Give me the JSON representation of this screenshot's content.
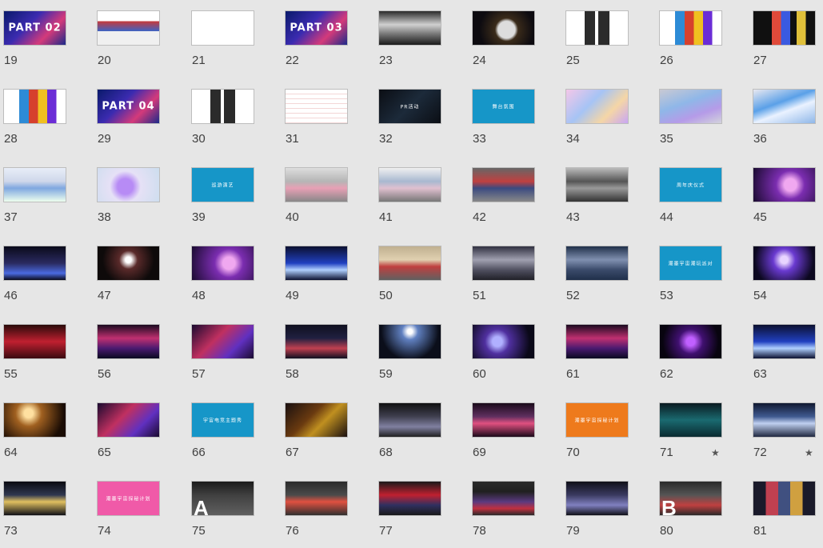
{
  "slides": [
    {
      "number": "19",
      "style": "s-space",
      "caption": "PART 02",
      "caption_size": "big"
    },
    {
      "number": "20",
      "style": "s-white-doc",
      "caption": ""
    },
    {
      "number": "21",
      "style": "s-white-pills",
      "caption": ""
    },
    {
      "number": "22",
      "style": "s-space",
      "caption": "PART 03",
      "caption_size": "big"
    },
    {
      "number": "23",
      "style": "s-robot2",
      "caption": ""
    },
    {
      "number": "24",
      "style": "s-astro",
      "caption": ""
    },
    {
      "number": "25",
      "style": "s-white-grid",
      "caption": ""
    },
    {
      "number": "26",
      "style": "s-white-color",
      "caption": ""
    },
    {
      "number": "27",
      "style": "s-posters",
      "caption": ""
    },
    {
      "number": "28",
      "style": "s-white-color",
      "caption": ""
    },
    {
      "number": "29",
      "style": "s-space",
      "caption": "PART 04",
      "caption_size": "big"
    },
    {
      "number": "30",
      "style": "s-white-grid",
      "caption": ""
    },
    {
      "number": "31",
      "style": "s-white-lines",
      "caption": ""
    },
    {
      "number": "32",
      "style": "s-tech",
      "caption": "PR活动"
    },
    {
      "number": "33",
      "style": "s-blue",
      "caption": "舞台氛围"
    },
    {
      "number": "34",
      "style": "s-pastel",
      "caption": ""
    },
    {
      "number": "35",
      "style": "s-inflat",
      "caption": ""
    },
    {
      "number": "36",
      "style": "s-inflat2",
      "caption": ""
    },
    {
      "number": "37",
      "style": "s-dome",
      "caption": ""
    },
    {
      "number": "38",
      "style": "s-planet",
      "caption": ""
    },
    {
      "number": "39",
      "style": "s-blue",
      "caption": "巡游演艺"
    },
    {
      "number": "40",
      "style": "s-mall",
      "caption": ""
    },
    {
      "number": "41",
      "style": "s-mall2",
      "caption": ""
    },
    {
      "number": "42",
      "style": "s-crowd",
      "caption": ""
    },
    {
      "number": "43",
      "style": "s-crowd2",
      "caption": ""
    },
    {
      "number": "44",
      "style": "s-blue",
      "caption": "周年庆仪式"
    },
    {
      "number": "45",
      "style": "s-purple",
      "caption": ""
    },
    {
      "number": "46",
      "style": "s-stage",
      "caption": ""
    },
    {
      "number": "47",
      "style": "s-stage2",
      "caption": ""
    },
    {
      "number": "48",
      "style": "s-purple",
      "caption": ""
    },
    {
      "number": "49",
      "style": "s-stage4",
      "caption": ""
    },
    {
      "number": "50",
      "style": "s-confetti",
      "caption": ""
    },
    {
      "number": "51",
      "style": "s-robot",
      "caption": ""
    },
    {
      "number": "52",
      "style": "s-crowdblue",
      "caption": ""
    },
    {
      "number": "53",
      "style": "s-blue",
      "caption": "潮墨宇宙潮玩派对"
    },
    {
      "number": "54",
      "style": "s-stage3",
      "caption": ""
    },
    {
      "number": "55",
      "style": "s-red",
      "caption": ""
    },
    {
      "number": "56",
      "style": "s-red2",
      "caption": ""
    },
    {
      "number": "57",
      "style": "s-redpurple",
      "caption": ""
    },
    {
      "number": "58",
      "style": "s-dance",
      "caption": ""
    },
    {
      "number": "59",
      "style": "s-light",
      "caption": ""
    },
    {
      "number": "60",
      "style": "s-singer",
      "caption": ""
    },
    {
      "number": "61",
      "style": "s-red2",
      "caption": ""
    },
    {
      "number": "62",
      "style": "s-violet",
      "caption": ""
    },
    {
      "number": "63",
      "style": "s-stage4",
      "caption": ""
    },
    {
      "number": "64",
      "style": "s-warm",
      "caption": ""
    },
    {
      "number": "65",
      "style": "s-redpurple",
      "caption": ""
    },
    {
      "number": "66",
      "style": "s-blue",
      "caption": "宇宙电竞主题秀"
    },
    {
      "number": "67",
      "style": "s-game",
      "caption": ""
    },
    {
      "number": "68",
      "style": "s-show",
      "caption": ""
    },
    {
      "number": "69",
      "style": "s-neon",
      "caption": ""
    },
    {
      "number": "70",
      "style": "s-orange",
      "caption": "潮墨宇宙探秘计划"
    },
    {
      "number": "71",
      "style": "s-teal",
      "caption": "",
      "starred": true
    },
    {
      "number": "72",
      "style": "s-sky",
      "caption": "",
      "starred": true
    },
    {
      "number": "73",
      "style": "s-gold",
      "caption": ""
    },
    {
      "number": "74",
      "style": "s-pink",
      "caption": "潮墨宇宙探秘计划"
    },
    {
      "number": "75",
      "style": "s-dark-a",
      "caption": "",
      "mark": "A"
    },
    {
      "number": "76",
      "style": "s-booth",
      "caption": ""
    },
    {
      "number": "77",
      "style": "s-booth2",
      "caption": ""
    },
    {
      "number": "78",
      "style": "s-booth3",
      "caption": ""
    },
    {
      "number": "79",
      "style": "s-booth4",
      "caption": ""
    },
    {
      "number": "80",
      "style": "s-booth5",
      "caption": "",
      "mark": "B"
    },
    {
      "number": "81",
      "style": "s-market",
      "caption": ""
    }
  ],
  "star_glyph": "★"
}
